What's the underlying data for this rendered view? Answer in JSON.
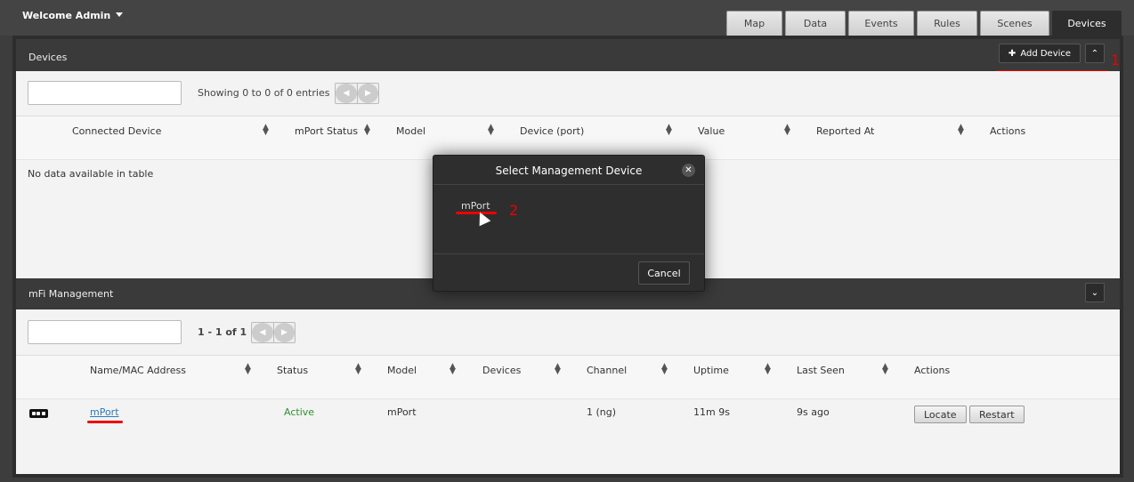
{
  "header": {
    "welcome": "Welcome Admin",
    "tabs": [
      "Map",
      "Data",
      "Events",
      "Rules",
      "Scenes",
      "Devices"
    ],
    "active_tab": "Devices"
  },
  "devices_panel": {
    "title": "Devices",
    "add_button": "Add Device",
    "entries_info": "Showing 0 to 0 of 0 entries",
    "columns": [
      "Connected Device",
      "mPort Status",
      "Model",
      "Device (port)",
      "Value",
      "Reported At",
      "Actions"
    ],
    "empty_text": "No data available in table"
  },
  "modal": {
    "title": "Select Management Device",
    "item": "mPort",
    "cancel": "Cancel"
  },
  "management_panel": {
    "title": "mFi Management",
    "pager_info": "1 - 1 of 1",
    "columns": [
      "Name/MAC Address",
      "Status",
      "Model",
      "Devices",
      "Channel",
      "Uptime",
      "Last Seen",
      "Actions"
    ],
    "row": {
      "name": "mPort",
      "status": "Active",
      "model": "mPort",
      "devices": "",
      "channel": "1 (ng)",
      "uptime": "11m 9s",
      "last_seen": "9s ago",
      "locate": "Locate",
      "restart": "Restart"
    }
  },
  "annotations": {
    "step1": "1",
    "step2": "2"
  },
  "colors": {
    "accent_red": "#ee0000",
    "link": "#2a7ab9",
    "active": "#2f8f2f"
  }
}
